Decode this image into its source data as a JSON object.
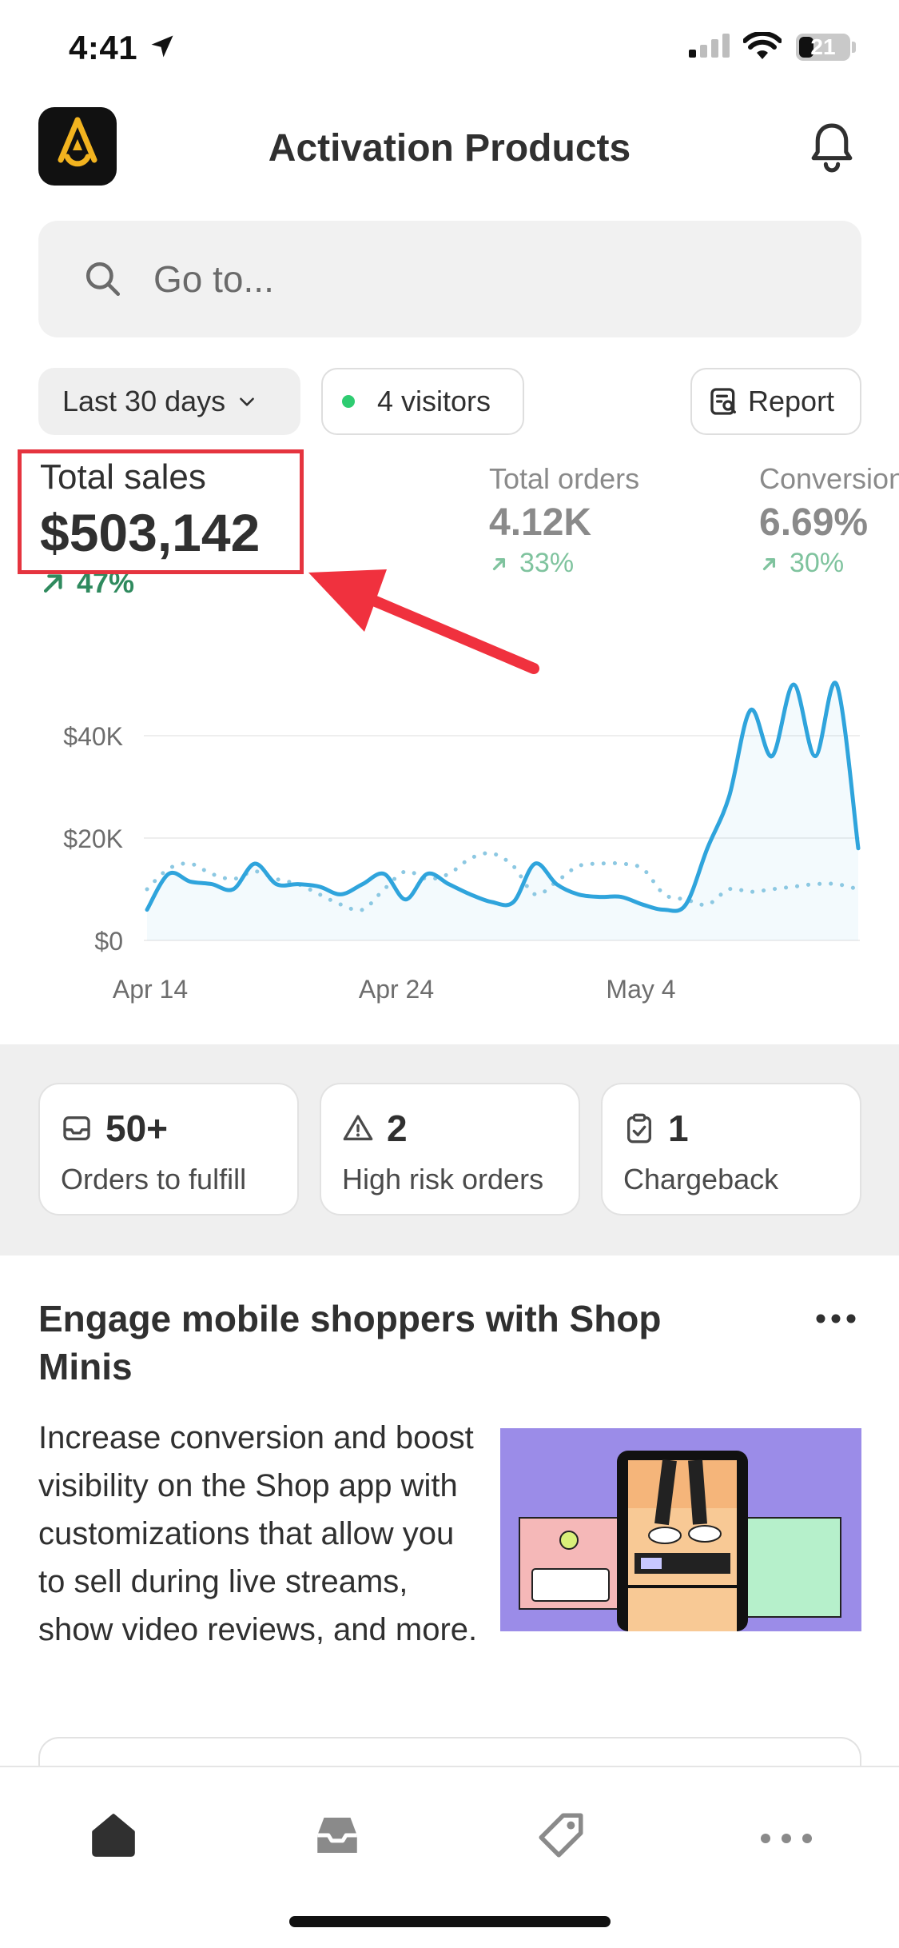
{
  "status_bar": {
    "time": "4:41",
    "battery": "21"
  },
  "header": {
    "title": "Activation Products"
  },
  "search": {
    "placeholder": "Go to..."
  },
  "filters": {
    "date_range": "Last 30 days",
    "visitors": "4 visitors",
    "report": "Report"
  },
  "metrics": [
    {
      "label": "Total sales",
      "value": "$503,142",
      "delta": "47%"
    },
    {
      "label": "Total orders",
      "value": "4.12K",
      "delta": "33%"
    },
    {
      "label": "Conversion",
      "value": "6.69%",
      "delta": "30%"
    }
  ],
  "chart_data": {
    "type": "line",
    "title": "",
    "xlabel": "",
    "ylabel": "",
    "ylim": [
      0,
      55000
    ],
    "y_ticks": [
      "$40K",
      "$20K",
      "$0"
    ],
    "x_ticks": [
      "Apr 14",
      "Apr 24",
      "May 4"
    ],
    "grid": true,
    "series": [
      {
        "style": "solid",
        "color": "#2fa4dc",
        "values": [
          6000,
          13000,
          11500,
          11000,
          10000,
          15000,
          11000,
          11000,
          10500,
          9000,
          11000,
          13000,
          8000,
          13000,
          11000,
          9000,
          7500,
          7500,
          15000,
          11000,
          9000,
          8500,
          8500,
          7000,
          6000,
          7000,
          18000,
          28000,
          45000,
          36000,
          50000,
          36000,
          50000,
          18000
        ]
      },
      {
        "style": "dotted",
        "color": "#8cc8e2",
        "values": [
          10000,
          14000,
          15000,
          13000,
          12000,
          13500,
          12000,
          11000,
          9000,
          7000,
          6000,
          10000,
          13500,
          12000,
          13000,
          16000,
          17000,
          14500,
          9000,
          11500,
          14500,
          15000,
          15000,
          14000,
          9000,
          8000,
          7000,
          10000,
          9500,
          10000,
          10500,
          11000,
          11000,
          10000
        ]
      }
    ]
  },
  "cards": [
    {
      "number": "50+",
      "label": "Orders to fulfill",
      "icon": "inbox-icon"
    },
    {
      "number": "2",
      "label": "High risk orders",
      "icon": "alert-triangle-icon"
    },
    {
      "number": "1",
      "label": "Chargeback",
      "icon": "clipboard-check-icon"
    }
  ],
  "promo": {
    "title": "Engage mobile shoppers with Shop Minis",
    "body": "Increase conversion and boost visibility on the Shop app with customizations that allow you to sell during live streams, show video reviews, and more."
  },
  "tabbar": [
    "home-icon",
    "orders-icon",
    "products-tag-icon",
    "more-icon"
  ],
  "colors": {
    "accent": "#2fa4dc",
    "positive": "#2f8a5e",
    "annotation": "#e5343f"
  }
}
